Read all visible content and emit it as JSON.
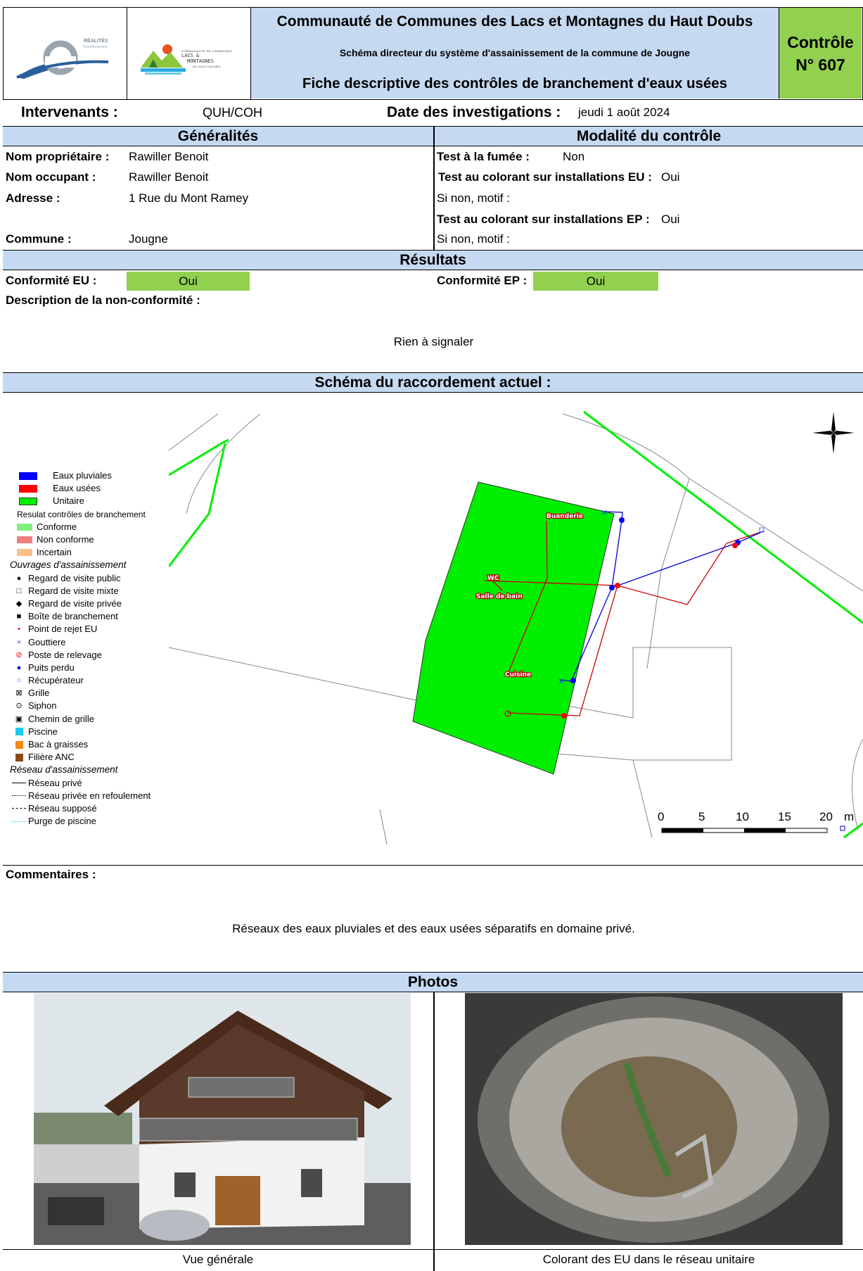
{
  "header": {
    "logo1_text": "RÉALITÉS",
    "logo1_sub": "Environnement",
    "logo2_lines": [
      "COMMUNAUTÉ DE COMMUNES",
      "LACS &",
      "MONTAGNES",
      "DU HAUT-DOUBS"
    ],
    "org": "Communauté de Communes des Lacs et Montagnes du Haut Doubs",
    "subtitle": "Schéma directeur du système d'assainissement de la commune de Jougne",
    "doc_title": "Fiche descriptive des contrôles de branchement d'eaux usées",
    "control_label": "Contrôle",
    "control_num": "N° 607"
  },
  "info": {
    "intervenants_label": "Intervenants :",
    "intervenants": "QUH/COH",
    "date_label": "Date des investigations :",
    "date": "jeudi 1 août 2024"
  },
  "generalites": {
    "title": "Généralités",
    "proprietaire_label": "Nom propriétaire :",
    "proprietaire": "Rawiller Benoit",
    "occupant_label": "Nom occupant :",
    "occupant": "Rawiller Benoit",
    "adresse_label": "Adresse :",
    "adresse": "1 Rue du Mont Ramey",
    "commune_label": "Commune :",
    "commune": "Jougne"
  },
  "modalite": {
    "title": "Modalité du contrôle",
    "fumee_label": "Test à la fumée :",
    "fumee": "Non",
    "eu_label": "Test au colorant sur installations EU :",
    "eu": "Oui",
    "motif1": "Si non, motif :",
    "ep_label": "Test au colorant sur installations EP :",
    "ep": "Oui",
    "motif2": "Si non, motif :"
  },
  "resultats": {
    "title": "Résultats",
    "conf_eu_label": "Conformité EU :",
    "conf_eu": "Oui",
    "conf_ep_label": "Conformité EP :",
    "conf_ep": "Oui",
    "desc_label": "Description de la non-conformité :",
    "desc": "Rien à signaler"
  },
  "schema": {
    "title": "Schéma du raccordement actuel :",
    "labels": {
      "buanderie": "Buanderie",
      "wc": "WC",
      "sdb": "Salle de bain",
      "cuisine": "Cuisine"
    },
    "scale": [
      "0",
      "5",
      "10",
      "15",
      "20",
      "m"
    ],
    "legend": {
      "networks": [
        "Eaux pluviales",
        "Eaux usées",
        "Unitaire"
      ],
      "resultat_title": "Resulat contrôles de branchement",
      "resultats": [
        "Conforme",
        "Non conforme",
        "Incertain"
      ],
      "ouvrages_title": "Ouvrages d'assainissement",
      "ouvrages": [
        "Regard de visite public",
        "Regard de visite mixte",
        "Regard de visite privée",
        "Boîte de branchement",
        "Point de rejet EU",
        "Gouttiere",
        "Poste de relevage",
        "Puits perdu",
        "Récupérateur",
        "Grille",
        "Siphon",
        "Chemin de grille",
        "Piscine",
        "Bac à graisses",
        "Filière ANC"
      ],
      "reseau_title": "Réseau d'assainissement",
      "reseaux": [
        "Réseau privé",
        "Réseau privée en refoulement",
        "Réseau supposé",
        "Purge de piscine"
      ]
    },
    "colors": {
      "ep": "#0000ff",
      "eu": "#ff0000",
      "unitaire": "#00ff00",
      "parcel": "#00ee00"
    }
  },
  "commentaires": {
    "label": "Commentaires :",
    "text": "Réseaux des eaux pluviales et des eaux usées séparatifs en domaine privé."
  },
  "photos": {
    "title": "Photos",
    "caption1": "Vue générale",
    "caption2": "Colorant des EU dans le réseau unitaire"
  }
}
